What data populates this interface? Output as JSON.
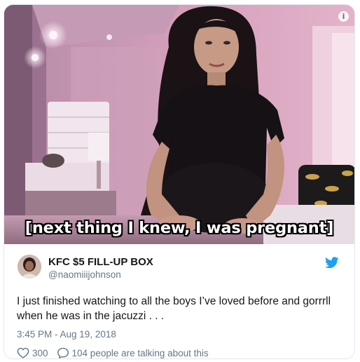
{
  "media": {
    "caption": "[next thing I knew, I was pregnant]",
    "info_icon": "info-icon"
  },
  "tweet": {
    "display_name": "KFC $5 FILL-UP BOX",
    "handle": "@naomiiijohnson",
    "text": "I just finished watching to all the boys I’ve loved before and gorrrll when he was in the jacuzzi . . .",
    "timestamp": "3:45 PM - Aug 19, 2018",
    "likes": "300",
    "replies_text": "104 people are talking about this",
    "brand_icon": "twitter-bird-icon"
  },
  "colors": {
    "brand": "#1da1f2",
    "text": "#14171a",
    "muted": "#657786",
    "border": "#e1e8ed"
  }
}
